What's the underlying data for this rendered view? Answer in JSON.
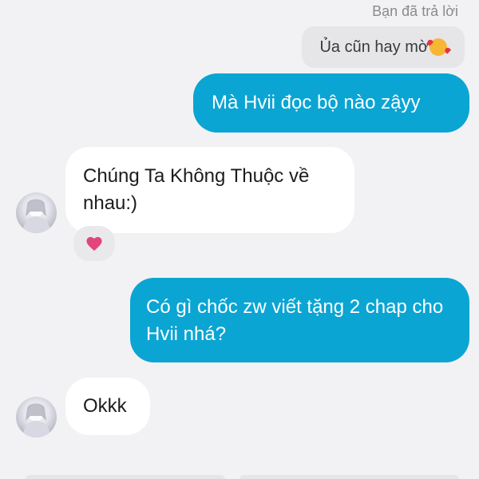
{
  "header": {
    "reply_label": "Bạn đã trả lời"
  },
  "quoted": {
    "text": "Ủa cũn hay mờ",
    "emoji": "smiling-face-with-hearts"
  },
  "messages": [
    {
      "direction": "outgoing",
      "text": "Mà Hvii đọc bộ nào zậyy"
    },
    {
      "direction": "incoming",
      "text": "Chúng Ta Không Thuộc về nhau:)",
      "reaction": "heart"
    },
    {
      "direction": "outgoing",
      "text": "Có gì chốc zw viết tặng 2 chap cho Hvii nhá?"
    },
    {
      "direction": "incoming",
      "text": "Okkk"
    }
  ],
  "colors": {
    "outgoing_bubble": "#0aa5d3",
    "incoming_bubble": "#ffffff",
    "quoted_bubble": "#e6e6e9",
    "reaction_heart": "#e0457b",
    "background": "#f2f2f4"
  }
}
